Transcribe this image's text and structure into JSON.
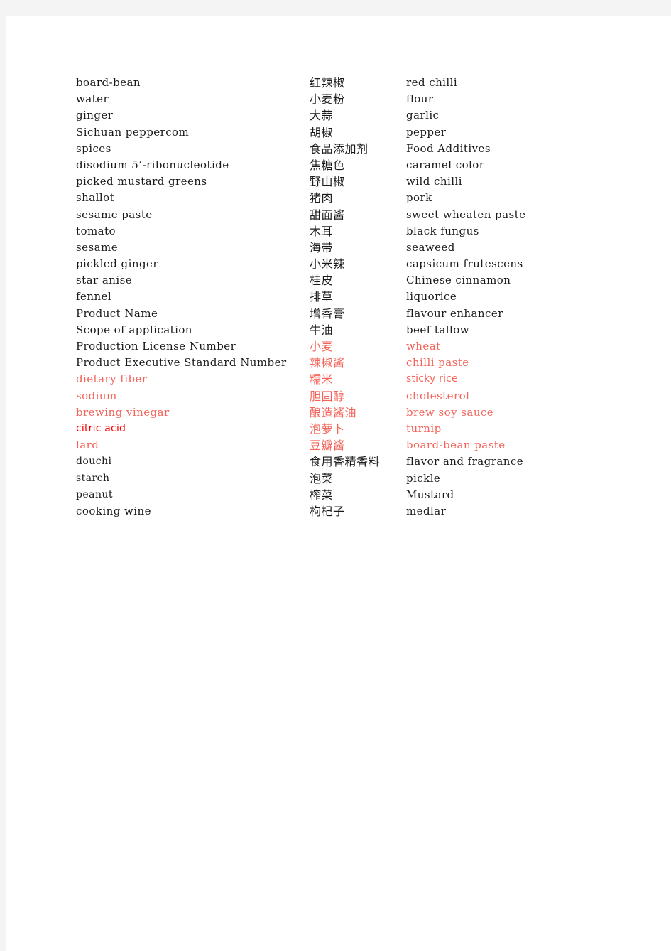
{
  "document": {
    "title": "Bilingual food ingredient glossary",
    "page_background": "#ffffff",
    "canvas_background": "#f4f4f4",
    "colors": {
      "text_black": "#1a1a1a",
      "text_red": "#f4645a",
      "text_hot_red": "#ff0000"
    }
  },
  "glossary": {
    "rows": [
      {
        "source": "board-bean",
        "zh": "红辣椒",
        "en": "red chilli",
        "source_tone": "black",
        "zh_tone": "black",
        "en_tone": "black",
        "source_face": "serif",
        "en_face": "serif"
      },
      {
        "source": "water",
        "zh": "小麦粉",
        "en": "flour",
        "source_tone": "black",
        "zh_tone": "black",
        "en_tone": "black",
        "source_face": "serif",
        "en_face": "serif"
      },
      {
        "source": "ginger",
        "zh": "大蒜",
        "en": "garlic",
        "source_tone": "black",
        "zh_tone": "black",
        "en_tone": "black",
        "source_face": "serif",
        "en_face": "serif"
      },
      {
        "source": "Sichuan peppercom",
        "zh": "胡椒",
        "en": "pepper",
        "source_tone": "black",
        "zh_tone": "black",
        "en_tone": "black",
        "source_face": "serif",
        "en_face": "serif"
      },
      {
        "source": "spices",
        "zh": "食品添加剂",
        "en": "Food Additives",
        "source_tone": "black",
        "zh_tone": "black",
        "en_tone": "black",
        "source_face": "serif",
        "en_face": "serif"
      },
      {
        "source": "disodium 5’-ribonucleotide",
        "zh": "焦糖色",
        "en": "caramel color",
        "source_tone": "black",
        "zh_tone": "black",
        "en_tone": "black",
        "source_face": "serif",
        "en_face": "serif"
      },
      {
        "source": "picked mustard greens",
        "zh": "野山椒",
        "en": "wild chilli",
        "source_tone": "black",
        "zh_tone": "black",
        "en_tone": "black",
        "source_face": "serif",
        "en_face": "serif"
      },
      {
        "source": "shallot",
        "zh": "猪肉",
        "en": "pork",
        "source_tone": "black",
        "zh_tone": "black",
        "en_tone": "black",
        "source_face": "serif",
        "en_face": "serif"
      },
      {
        "source": "sesame paste",
        "zh": "甜面酱",
        "en": "sweet wheaten paste",
        "source_tone": "black",
        "zh_tone": "black",
        "en_tone": "black",
        "source_face": "serif",
        "en_face": "serif"
      },
      {
        "source": "tomato",
        "zh": "木耳",
        "en": "black fungus",
        "source_tone": "black",
        "zh_tone": "black",
        "en_tone": "black",
        "source_face": "serif",
        "en_face": "serif"
      },
      {
        "source": "sesame",
        "zh": "海带",
        "en": "seaweed",
        "source_tone": "black",
        "zh_tone": "black",
        "en_tone": "black",
        "source_face": "serif",
        "en_face": "serif"
      },
      {
        "source": "pickled ginger",
        "zh": "小米辣",
        "en": "capsicum frutescens",
        "source_tone": "black",
        "zh_tone": "black",
        "en_tone": "black",
        "source_face": "serif",
        "en_face": "serif"
      },
      {
        "source": "star anise",
        "zh": "桂皮",
        "en": "Chinese cinnamon",
        "source_tone": "black",
        "zh_tone": "black",
        "en_tone": "black",
        "source_face": "serif",
        "en_face": "serif"
      },
      {
        "source": "fennel",
        "zh": "排草",
        "en": "liquorice",
        "source_tone": "black",
        "zh_tone": "black",
        "en_tone": "black",
        "source_face": "serif",
        "en_face": "serif"
      },
      {
        "source": "Product Name",
        "zh": "增香膏",
        "en": "flavour enhancer",
        "source_tone": "black",
        "zh_tone": "black",
        "en_tone": "black",
        "source_face": "serif",
        "en_face": "serif"
      },
      {
        "source": "Scope of application",
        "zh": "牛油",
        "en": "beef tallow",
        "source_tone": "black",
        "zh_tone": "black",
        "en_tone": "black",
        "source_face": "serif",
        "en_face": "serif"
      },
      {
        "source": "Production License Number",
        "zh": "小麦",
        "en": "wheat",
        "source_tone": "black",
        "zh_tone": "red",
        "en_tone": "red",
        "source_face": "serif",
        "en_face": "serif"
      },
      {
        "source": "Product Executive Standard Number",
        "zh": "辣椒酱",
        "en": "chilli paste",
        "source_tone": "black",
        "zh_tone": "red",
        "en_tone": "red",
        "source_face": "serif",
        "en_face": "serif"
      },
      {
        "source": "dietary fiber",
        "zh": "糯米",
        "en": "sticky rice",
        "source_tone": "red",
        "zh_tone": "red",
        "en_tone": "red",
        "source_face": "serif",
        "en_face": "sans"
      },
      {
        "source": "sodium",
        "zh": "胆固醇",
        "en": "cholesterol",
        "source_tone": "red",
        "zh_tone": "red",
        "en_tone": "red",
        "source_face": "serif",
        "en_face": "serif"
      },
      {
        "source": "brewing vinegar",
        "zh": "酿造酱油",
        "en": "brew soy sauce",
        "source_tone": "red",
        "zh_tone": "red",
        "en_tone": "red",
        "source_face": "serif",
        "en_face": "serif"
      },
      {
        "source": "citric acid",
        "zh": "泡萝卜",
        "en": "turnip",
        "source_tone": "hot",
        "zh_tone": "red",
        "en_tone": "red",
        "source_face": "sans",
        "en_face": "serif"
      },
      {
        "source": "lard",
        "zh": "豆瓣酱",
        "en": "board-bean paste",
        "source_tone": "red",
        "zh_tone": "red",
        "en_tone": "red",
        "source_face": "serif",
        "en_face": "serif"
      },
      {
        "source": "douchi",
        "zh": "食用香精香料",
        "en": "flavor and fragrance",
        "source_tone": "black",
        "zh_tone": "black",
        "en_tone": "black",
        "source_face": "narrow",
        "en_face": "serif"
      },
      {
        "source": "starch",
        "zh": "泡菜",
        "en": "pickle",
        "source_tone": "black",
        "zh_tone": "black",
        "en_tone": "black",
        "source_face": "narrow",
        "en_face": "serif"
      },
      {
        "source": "peanut",
        "zh": "榨菜",
        "en": "Mustard",
        "source_tone": "black",
        "zh_tone": "black",
        "en_tone": "black",
        "source_face": "narrow",
        "en_face": "serif"
      },
      {
        "source": "cooking wine",
        "zh": "枸杞子",
        "en": "medlar",
        "source_tone": "black",
        "zh_tone": "black",
        "en_tone": "black",
        "source_face": "serif",
        "en_face": "serif"
      }
    ]
  }
}
